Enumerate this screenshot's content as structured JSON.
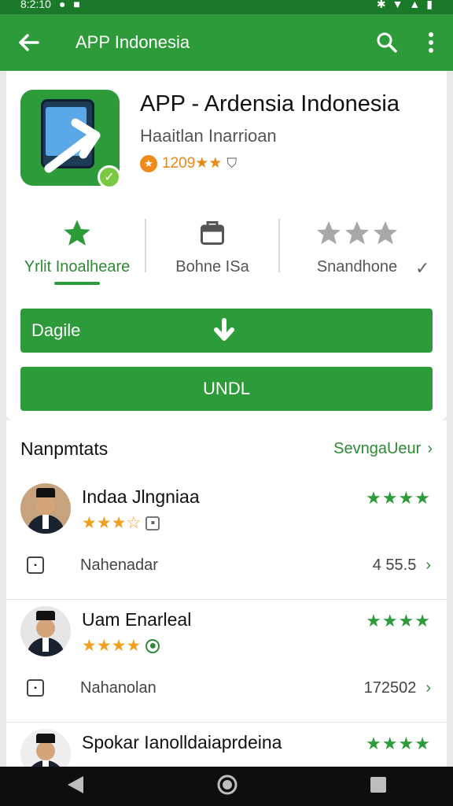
{
  "status_bar": {
    "time": "8:2:10"
  },
  "app_bar": {
    "title": "APP Indonesia"
  },
  "app": {
    "name": "APP - Ardensia Indonesia",
    "developer": "Haaitlan Inarrioan",
    "rating_text": "1209★★"
  },
  "tabs": [
    {
      "label": "Yrlit Inoalheare",
      "icon": "star-icon"
    },
    {
      "label": "Bohne ISa",
      "icon": "briefcase-icon"
    },
    {
      "label": "Snandhone",
      "icon": "three-stars-icon"
    }
  ],
  "buttons": {
    "download_label": "Dagile",
    "install_label": "UNDL"
  },
  "reviews": {
    "title": "Nanpmtats",
    "see_all": "SevngaUeur",
    "items": [
      {
        "name": "Indaa Jlngniaa",
        "stars": "★★★☆",
        "rating": "★★★★",
        "row_label": "Nahenadar",
        "row_value": "4 55.5"
      },
      {
        "name": "Uam Enarleal",
        "stars": "★★★★",
        "rating": "★★★★",
        "row_label": "Nahanolan",
        "row_value": "172502"
      },
      {
        "name": "Spokar Ianolldaiaprdeina",
        "stars": "",
        "rating": "★★★★"
      }
    ]
  },
  "colors": {
    "primary": "#2e9b3a",
    "status_bar": "#1b7a2a",
    "star_orange": "#f0a020"
  }
}
